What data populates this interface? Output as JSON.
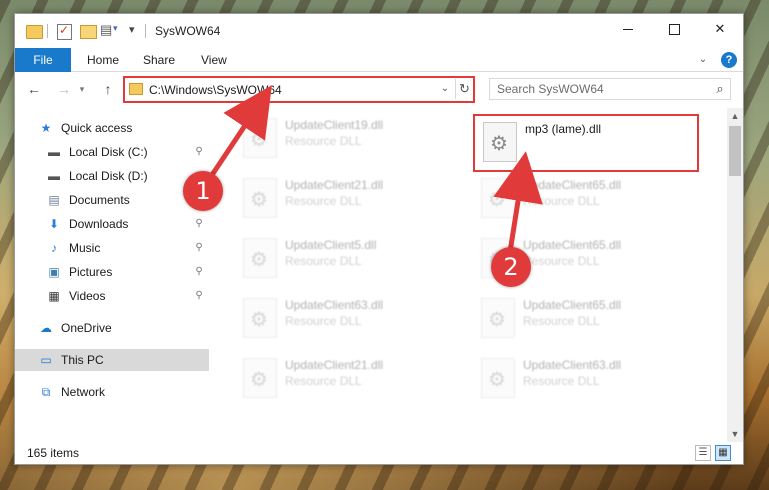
{
  "window": {
    "title": "SysWOW64",
    "controls": {
      "minimize": "",
      "maximize": "",
      "close": ""
    }
  },
  "ribbon": {
    "file_tab": "File",
    "tabs": [
      "Home",
      "Share",
      "View"
    ]
  },
  "navigation": {
    "address": "C:\\Windows\\SysWOW64",
    "search_placeholder": "Search SysWOW64"
  },
  "sidebar": {
    "items": [
      {
        "label": "Quick access",
        "icon": "star-icon"
      },
      {
        "label": "Local Disk (C:)",
        "icon": "drive-icon",
        "pinned": true
      },
      {
        "label": "Local Disk (D:)",
        "icon": "drive-icon"
      },
      {
        "label": "Documents",
        "icon": "documents-icon",
        "pinned": true
      },
      {
        "label": "Downloads",
        "icon": "download-icon",
        "pinned": true
      },
      {
        "label": "Music",
        "icon": "music-icon",
        "pinned": true
      },
      {
        "label": "Pictures",
        "icon": "pictures-icon",
        "pinned": true
      },
      {
        "label": "Videos",
        "icon": "videos-icon",
        "pinned": true
      },
      {
        "label": "OneDrive",
        "icon": "cloud-icon"
      },
      {
        "label": "This PC",
        "icon": "computer-icon",
        "selected": true
      },
      {
        "label": "Network",
        "icon": "network-icon"
      }
    ]
  },
  "files": {
    "left_column": [
      {
        "name": "UpdateClient19.dll",
        "type": "Resource DLL"
      },
      {
        "name": "UpdateClient21.dll",
        "type": "Resource DLL"
      },
      {
        "name": "UpdateClient5.dll",
        "type": "Resource DLL"
      },
      {
        "name": "UpdateClient63.dll",
        "type": "Resource DLL"
      },
      {
        "name": "UpdateClient21.dll",
        "type": "Resource DLL"
      }
    ],
    "right_column": [
      {
        "name": "mp3 (lame).dll",
        "type": ""
      },
      {
        "name": "UpdateClient65.dll",
        "type": "Resource DLL"
      },
      {
        "name": "UpdateClient65.dll",
        "type": "Resource DLL"
      },
      {
        "name": "UpdateClient65.dll",
        "type": "Resource DLL"
      },
      {
        "name": "UpdateClient63.dll",
        "type": "Resource DLL"
      }
    ]
  },
  "status": {
    "item_count": "165 items"
  },
  "annotations": {
    "badge_1": "1",
    "badge_2": "2",
    "highlight_color": "#e03a3a"
  },
  "colors": {
    "accent": "#1979ca",
    "selection": "#cce8ff",
    "highlight": "#e03a3a"
  }
}
